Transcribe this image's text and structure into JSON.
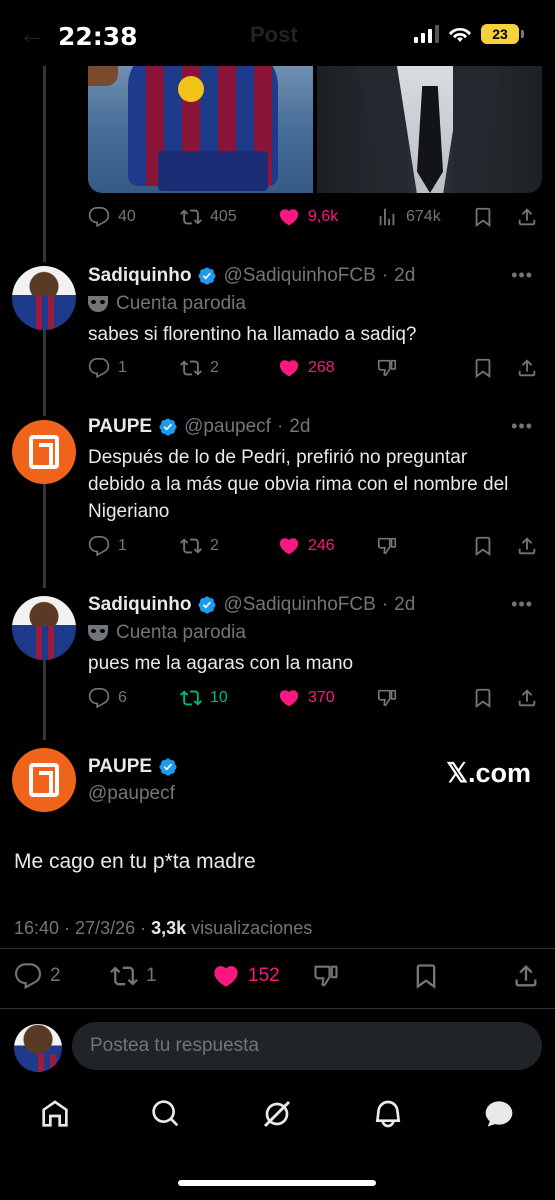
{
  "status_bar": {
    "time": "22:38",
    "battery": "23",
    "ghost_title": "Post"
  },
  "top_tweet_actions": {
    "replies": "40",
    "retweets": "405",
    "likes": "9,6k",
    "views": "674k"
  },
  "replies": [
    {
      "name": "Sadiquinho",
      "handle": "@SadiquinhoFCB",
      "time": "2d",
      "parody_label": "Cuenta parodia",
      "text": "sabes si florentino ha llamado a sadiq?",
      "replies": "1",
      "retweets": "2",
      "likes": "268"
    },
    {
      "name": "PAUPE",
      "handle": "@paupecf",
      "time": "2d",
      "text": "Después de lo de Pedri, prefirió no preguntar debido a la más que obvia rima con el nombre del Nigeriano",
      "replies": "1",
      "retweets": "2",
      "likes": "246"
    },
    {
      "name": "Sadiquinho",
      "handle": "@SadiquinhoFCB",
      "time": "2d",
      "parody_label": "Cuenta parodia",
      "text": "pues me la agaras con la mano",
      "replies": "6",
      "retweets": "10",
      "likes": "370"
    }
  ],
  "main_tweet": {
    "name": "PAUPE",
    "handle": "@paupecf",
    "watermark": "𝕏.com",
    "text": "Me cago en tu p*ta madre",
    "timestamp": "16:40 · 27/3/26 · ",
    "views_count": "3,3k",
    "views_label": " visualizaciones",
    "replies": "2",
    "retweets": "1",
    "likes": "152"
  },
  "reply_bar": {
    "placeholder": "Postea tu respuesta"
  },
  "nav": [
    "home-icon",
    "search-icon",
    "grok-icon",
    "notifications-icon",
    "messages-icon"
  ],
  "colors": {
    "like": "#f91880",
    "retweet": "#00ba7c",
    "verified": "#1d9bf0",
    "muted": "#71767b",
    "paupe_orange": "#f0631a"
  }
}
